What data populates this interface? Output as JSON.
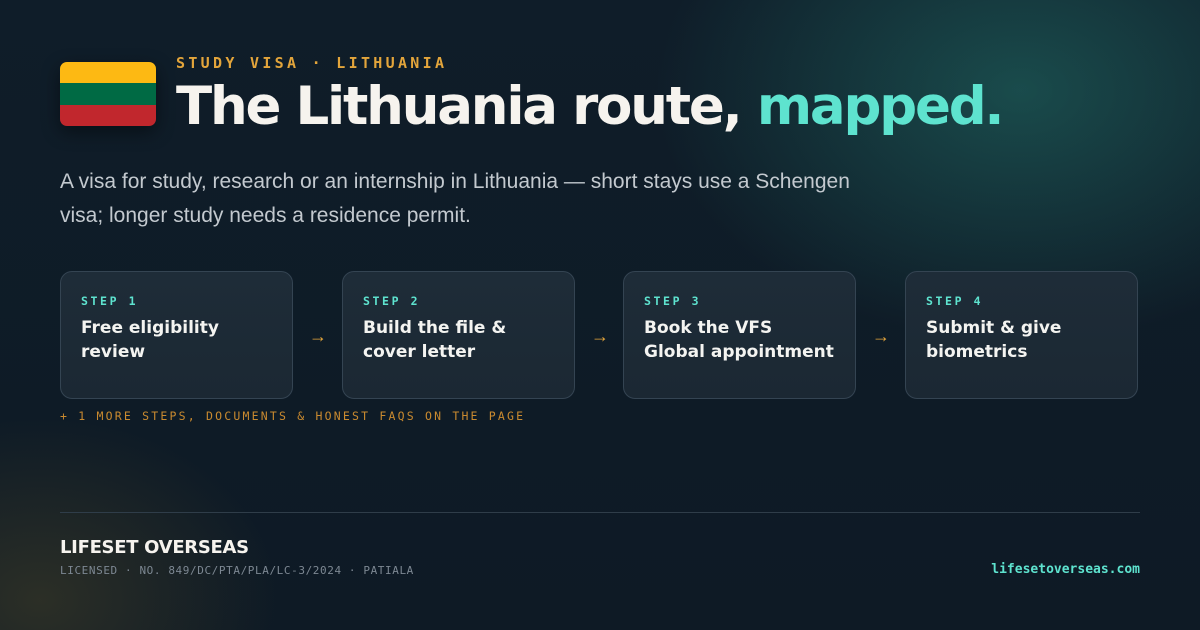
{
  "flag": {
    "name": "lithuania-flag",
    "stripes": [
      "#fdb913",
      "#006a44",
      "#c1272d"
    ]
  },
  "header": {
    "eyebrow": "STUDY VISA · LITHUANIA",
    "title_main": "The Lithuania route,",
    "title_accent": "mapped."
  },
  "intro": "A visa for study, research or an internship in Lithuania — short stays use a Schengen visa; longer study needs a residence permit.",
  "steps": [
    {
      "number": "STEP 1",
      "title": "Free eligibility review"
    },
    {
      "number": "STEP 2",
      "title": "Build the file & cover letter"
    },
    {
      "number": "STEP 3",
      "title": "Book the VFS Global appointment"
    },
    {
      "number": "STEP 4",
      "title": "Submit & give biometrics"
    }
  ],
  "arrow_glyph": "→",
  "more_note": "+ 1 MORE STEPS, DOCUMENTS & HONEST FAQS ON THE PAGE",
  "footer": {
    "brand": "LIFESET OVERSEAS",
    "license": "LICENSED · NO. 849/DC/PTA/PLA/LC-3/2024 · PATIALA",
    "website": "lifesetoverseas.com"
  },
  "colors": {
    "accent_teal": "#5ee3cf",
    "accent_amber": "#e3a53b",
    "background": "#0f1d29"
  }
}
